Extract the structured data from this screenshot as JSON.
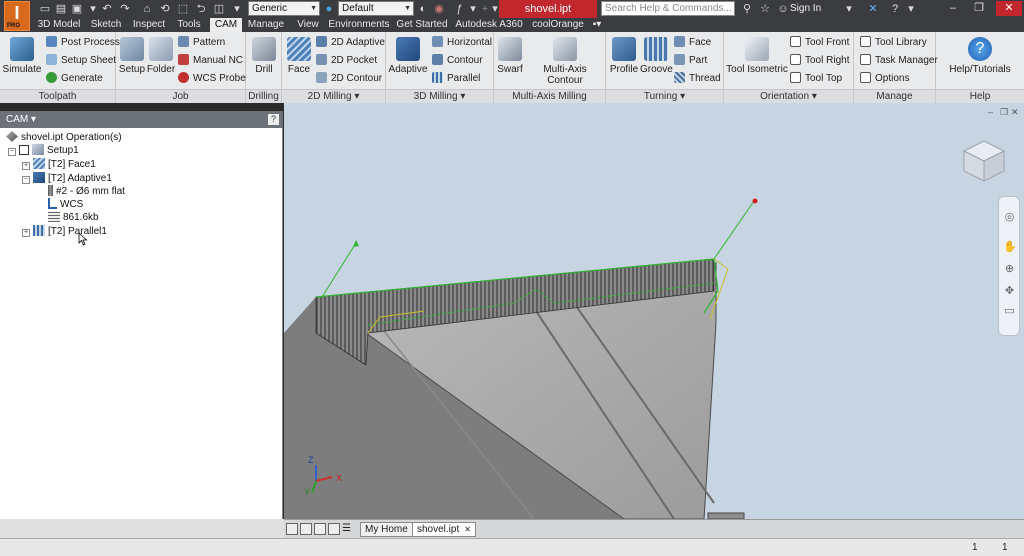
{
  "app": {
    "logo": "I",
    "logo_sub": "PRO"
  },
  "quick_access": {
    "material": "Generic",
    "appearance": "Default"
  },
  "doc_title": "shovel.ipt",
  "search": {
    "placeholder": "Search Help & Commands..."
  },
  "signin": "Sign In",
  "tabs": [
    {
      "label": "3D Model"
    },
    {
      "label": "Sketch"
    },
    {
      "label": "Inspect"
    },
    {
      "label": "Tools"
    },
    {
      "label": "CAM"
    },
    {
      "label": "Manage"
    },
    {
      "label": "View"
    },
    {
      "label": "Environments"
    },
    {
      "label": "Get Started"
    },
    {
      "label": "Autodesk A360"
    },
    {
      "label": "coolOrange"
    }
  ],
  "ribbon": {
    "toolpath": {
      "title": "Toolpath",
      "simulate": "Simulate",
      "post_process": "Post Process",
      "setup_sheet": "Setup Sheet",
      "generate": "Generate"
    },
    "job": {
      "title": "Job",
      "setup": "Setup",
      "folder": "Folder",
      "pattern": "Pattern",
      "manual_nc": "Manual NC",
      "wcs_probe": "WCS Probe"
    },
    "drilling": {
      "title": "Drilling",
      "drill": "Drill"
    },
    "milling2d": {
      "title": "2D Milling ▾",
      "face": "Face",
      "adaptive2d": "2D Adaptive",
      "pocket2d": "2D Pocket",
      "contour2d": "2D Contour"
    },
    "milling3d": {
      "title": "3D Milling ▾",
      "adaptive": "Adaptive",
      "horizontal": "Horizontal",
      "contour": "Contour",
      "parallel": "Parallel"
    },
    "multiaxis": {
      "title": "Multi-Axis Milling",
      "swarf": "Swarf",
      "multiaxis_contour": "Multi-Axis Contour"
    },
    "turning": {
      "title": "Turning ▾",
      "profile": "Profile",
      "groove": "Groove",
      "face": "Face",
      "part": "Part",
      "thread": "Thread"
    },
    "orientation": {
      "title": "Orientation ▾",
      "tool_isometric": "Tool Isometric",
      "tool_front": "Tool Front",
      "tool_right": "Tool Right",
      "tool_top": "Tool Top"
    },
    "manage": {
      "title": "Manage",
      "tool_library": "Tool Library",
      "task_manager": "Task Manager",
      "options": "Options"
    },
    "help": {
      "title": "Help",
      "help_tutorials": "Help/Tutorials"
    }
  },
  "browser": {
    "title": "CAM ▾",
    "help": "?",
    "tree": [
      {
        "label": "shovel.ipt Operation(s)"
      },
      {
        "label": "Setup1"
      },
      {
        "label": "[T2] Face1"
      },
      {
        "label": "[T2] Adaptive1"
      },
      {
        "label": "#2 - Ø6 mm flat"
      },
      {
        "label": "WCS"
      },
      {
        "label": "861.6kb"
      },
      {
        "label": "[T2] Parallel1"
      }
    ]
  },
  "triad": {
    "x": "X",
    "y": "Y",
    "z": "Z"
  },
  "bottom_tabs": [
    {
      "label": "My Home"
    },
    {
      "label": "shovel.ipt"
    }
  ],
  "status": {
    "count1": "1",
    "count2": "1"
  },
  "colors": {
    "cam_tab_active": "#ececec",
    "doc_title_bg": "#c1272d",
    "viewport_bg": "#c7d5e2",
    "toolpath_green": "#2fb52f"
  }
}
